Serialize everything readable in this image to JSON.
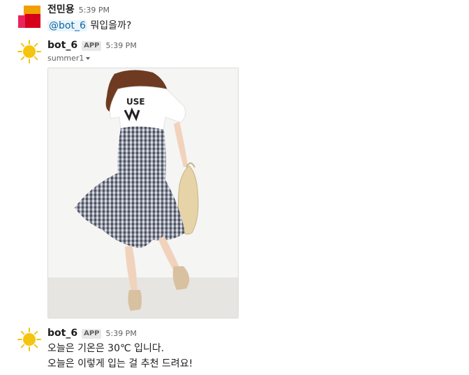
{
  "messages": [
    {
      "username": "전민용",
      "time": "5:39 PM",
      "mention": "@bot_6",
      "text": "뭐입을까?",
      "avatar_icon": "user-avatar-icon"
    },
    {
      "username": "bot_6",
      "badge": "APP",
      "time": "5:39 PM",
      "attachment_title": "summer1",
      "avatar_icon": "sun-icon"
    },
    {
      "username": "bot_6",
      "badge": "APP",
      "time": "5:39 PM",
      "line1": "오늘은 기온은 30℃ 입니다.",
      "line2": "오늘은 이렇게 입는 걸 추천 드려요!",
      "avatar_icon": "sun-icon"
    }
  ],
  "colors": {
    "mention": "#1264a3",
    "mention_bg": "#e8f5fa",
    "sun": "#f4c40f"
  }
}
